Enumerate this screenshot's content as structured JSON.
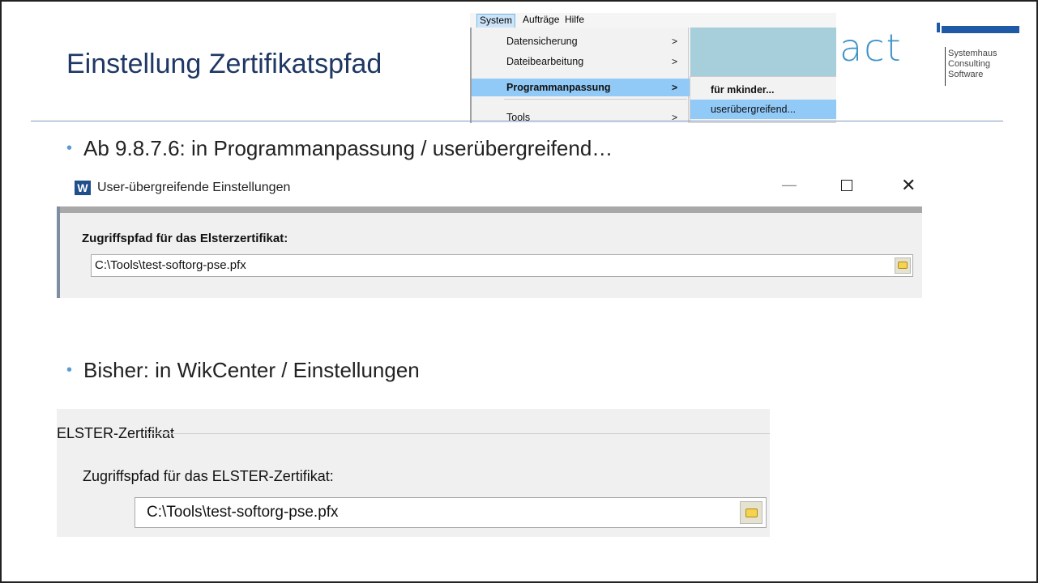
{
  "slide": {
    "title": "Einstellung Zertifikatspfad",
    "bullets": [
      "Ab 9.8.7.6: in Programmanpassung / userübergreifend…",
      "Bisher: in WikCenter / Einstellungen"
    ],
    "bullet_glyph": "•"
  },
  "logo": {
    "text": "act",
    "lines": [
      "Systemhaus",
      "Consulting",
      "Software"
    ]
  },
  "menu": {
    "bar": [
      "System",
      "Aufträge",
      "Hilfe"
    ],
    "items": [
      {
        "label": "Datensicherung",
        "arrow": ">"
      },
      {
        "label": "Dateibearbeitung",
        "arrow": ">"
      },
      {
        "label": "Programmanpassung",
        "arrow": ">"
      },
      {
        "label": "Tools",
        "arrow": ">"
      }
    ],
    "submenu": [
      "für mkinder...",
      "userübergreifend..."
    ]
  },
  "dialog1": {
    "icon_letter": "W",
    "title": "User-übergreifende Einstellungen",
    "min_glyph": "—",
    "close_glyph": "✕",
    "label": "Zugriffspfad für das Elsterzertifikat:",
    "value": "C:\\Tools\\test-softorg-pse.pfx"
  },
  "dialog2": {
    "group": "ELSTER-Zertifikat",
    "label": "Zugriffspfad für das ELSTER-Zertifikat:",
    "value": "C:\\Tools\\test-softorg-pse.pfx"
  },
  "colors": {
    "title": "#1f3864",
    "bullet": "#5b9bd5",
    "menu_highlight": "#91c9f7",
    "logo_blue": "#3f93c8"
  }
}
